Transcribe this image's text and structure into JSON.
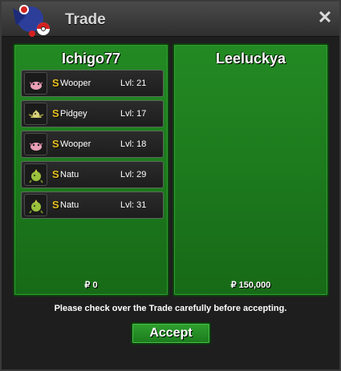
{
  "window": {
    "title": "Trade",
    "close_glyph": "✕"
  },
  "left_panel": {
    "trainer": "Ichigo77",
    "money": "₽ 0",
    "pokemon": [
      {
        "badge": "S",
        "name": "Wooper",
        "level": "Lvl: 21",
        "icon": "wooper-icon",
        "color": "#e9a0b6"
      },
      {
        "badge": "S",
        "name": "Pidgey",
        "level": "Lvl: 17",
        "icon": "pidgey-icon",
        "color": "#c9c96a"
      },
      {
        "badge": "S",
        "name": "Wooper",
        "level": "Lvl: 18",
        "icon": "wooper-icon",
        "color": "#e9a0b6"
      },
      {
        "badge": "S",
        "name": "Natu",
        "level": "Lvl: 29",
        "icon": "natu-icon",
        "color": "#9ac23c"
      },
      {
        "badge": "S",
        "name": "Natu",
        "level": "Lvl: 31",
        "icon": "natu-icon",
        "color": "#9ac23c"
      }
    ]
  },
  "right_panel": {
    "trainer": "Leeluckya",
    "money": "₽ 150,000"
  },
  "footer": {
    "notice": "Please check over the Trade carefully before accepting.",
    "accept_label": "Accept"
  },
  "colors": {
    "panel_green": "#1d7a1d",
    "shiny_badge": "#e8c020"
  }
}
